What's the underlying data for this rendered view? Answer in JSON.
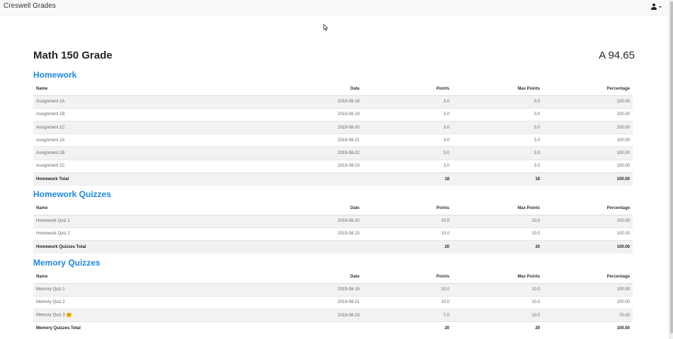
{
  "navbar": {
    "brand": "Creswell Grades",
    "user_menu_icon": "user-icon"
  },
  "page": {
    "title": "Math 150 Grade",
    "overall_grade": "A 94.65"
  },
  "columns": {
    "name": "Name",
    "date": "Date",
    "points": "Points",
    "max_points": "Max Points",
    "percentage": "Percentage"
  },
  "sections": [
    {
      "title": "Homework",
      "rows": [
        {
          "name": "Assignment 1A",
          "date": "2019-08-18",
          "points": "3.0",
          "max_points": "3.0",
          "percentage": "100.00"
        },
        {
          "name": "Assignment 1B",
          "date": "2019-08-19",
          "points": "3.0",
          "max_points": "3.0",
          "percentage": "100.00"
        },
        {
          "name": "Assignment 1C",
          "date": "2019-08-20",
          "points": "3.0",
          "max_points": "3.0",
          "percentage": "100.00"
        },
        {
          "name": "Assignment 2A",
          "date": "2019-08-21",
          "points": "3.0",
          "max_points": "3.0",
          "percentage": "100.00"
        },
        {
          "name": "Assignment 2B",
          "date": "2019-08-22",
          "points": "3.0",
          "max_points": "3.0",
          "percentage": "100.00"
        },
        {
          "name": "Assignment 2C",
          "date": "2019-08-23",
          "points": "3.0",
          "max_points": "3.0",
          "percentage": "100.00"
        }
      ],
      "total": {
        "name": "Homework Total",
        "points": "18",
        "max_points": "18",
        "percentage": "100.00"
      }
    },
    {
      "title": "Homework Quizzes",
      "rows": [
        {
          "name": "Homework Quiz 1",
          "date": "2019-08-20",
          "points": "10.0",
          "max_points": "10.0",
          "percentage": "100.00"
        },
        {
          "name": "Homework Quiz 2",
          "date": "2019-08-23",
          "points": "10.0",
          "max_points": "10.0",
          "percentage": "100.00"
        }
      ],
      "total": {
        "name": "Homework Quizzes Total",
        "points": "20",
        "max_points": "20",
        "percentage": "100.00"
      }
    },
    {
      "title": "Memory Quizzes",
      "rows": [
        {
          "name": "Memory Quiz 1",
          "date": "2019-08-19",
          "points": "10.0",
          "max_points": "10.0",
          "percentage": "100.00"
        },
        {
          "name": "Memory Quiz 2",
          "date": "2019-08-21",
          "points": "10.0",
          "max_points": "10.0",
          "percentage": "100.00"
        },
        {
          "name": "Memory Quiz 3",
          "date": "2019-08-23",
          "points": "7.0",
          "max_points": "10.0",
          "percentage": "70.00",
          "badge": "★"
        }
      ],
      "total": {
        "name": "Memory Quizzes Total",
        "points": "20",
        "max_points": "20",
        "percentage": "100.00"
      }
    }
  ],
  "colors": {
    "section_title": "#1e88e5",
    "badge": "#f0c419",
    "navbar_bg": "#f8f9fa"
  }
}
